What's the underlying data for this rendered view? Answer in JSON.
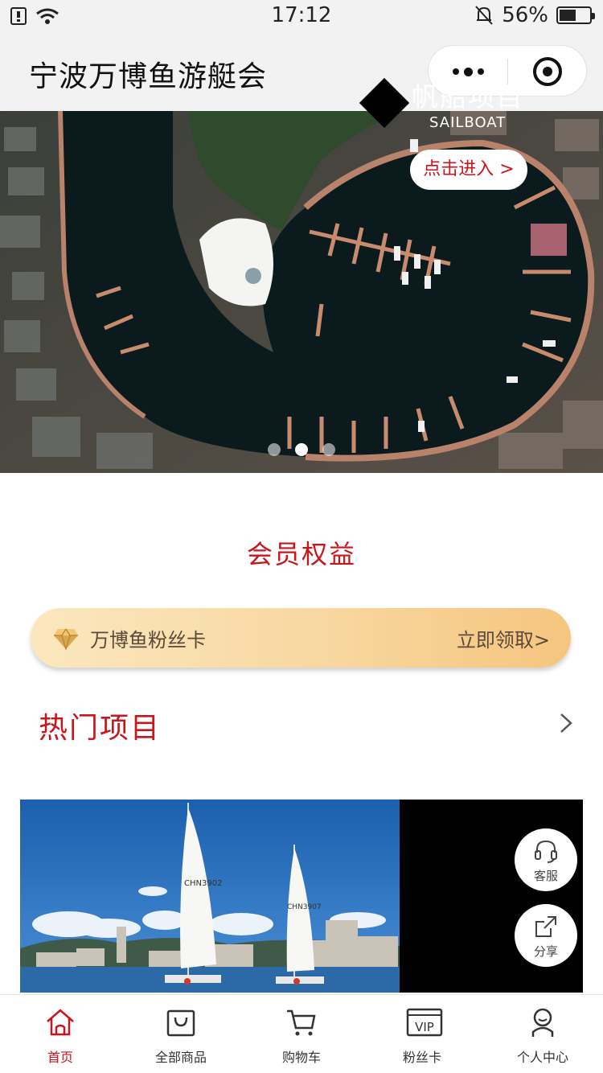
{
  "status_bar": {
    "time": "17:12",
    "battery_percent": "56%",
    "battery_level": 0.56
  },
  "nav": {
    "title": "宁波万博鱼游艇会",
    "more_icon": "more-dots-icon",
    "close_icon": "target-close-icon"
  },
  "banner": {
    "slide_count": 3,
    "active_slide": 1
  },
  "member": {
    "section_title": "会员权益",
    "fan_card_label": "万博鱼粉丝卡",
    "fan_card_action": "立即领取>"
  },
  "hot": {
    "title": "热门项目",
    "project": {
      "title": "帆船项目",
      "subtitle": "SAILBOAT",
      "button": "点击进入 >",
      "sail_left_text": "CHN3902",
      "sail_right_text": "CHN3907"
    }
  },
  "floating": {
    "service_label": "客服",
    "share_label": "分享"
  },
  "tabbar": {
    "items": [
      {
        "label": "首页",
        "icon": "home-icon",
        "active": true
      },
      {
        "label": "全部商品",
        "icon": "shopping-bag-icon",
        "active": false
      },
      {
        "label": "购物车",
        "icon": "cart-icon",
        "active": false
      },
      {
        "label": "粉丝卡",
        "icon": "vip-card-icon",
        "active": false
      },
      {
        "label": "个人中心",
        "icon": "user-icon",
        "active": false
      }
    ]
  },
  "colors": {
    "accent_red": "#c8161d",
    "card_gold_start": "#fbe7bf",
    "card_gold_end": "#f5c57e"
  }
}
